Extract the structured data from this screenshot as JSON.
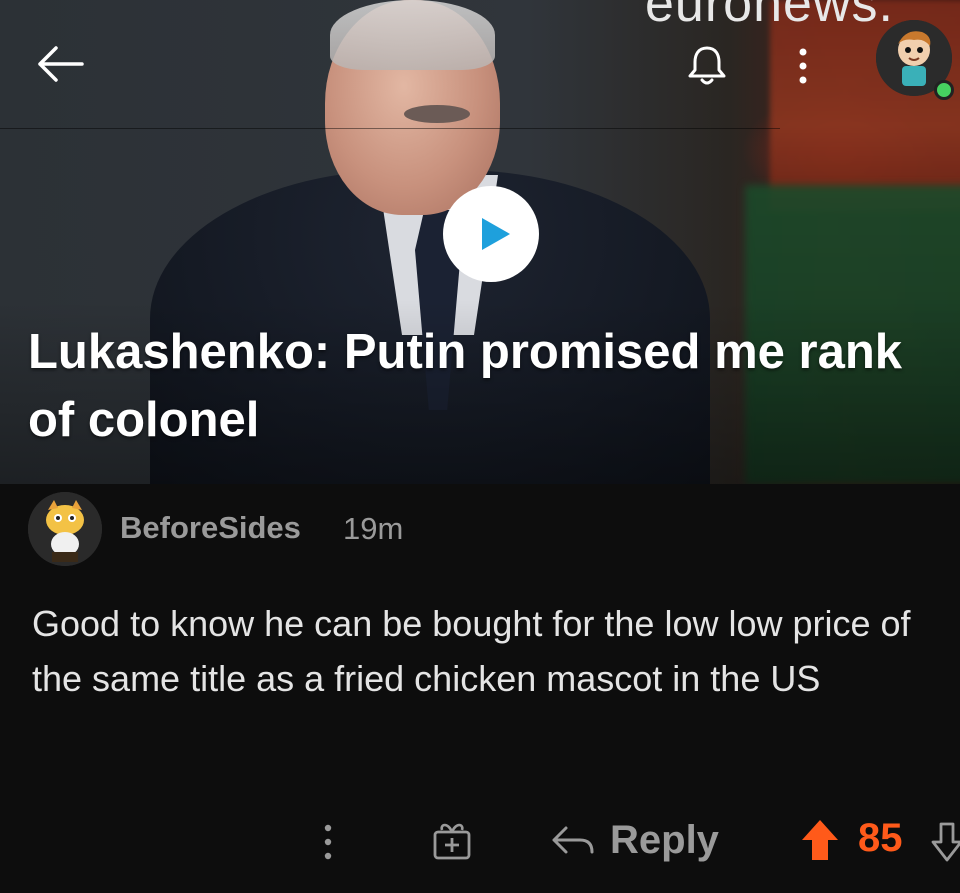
{
  "post": {
    "brand_watermark": "euronews.",
    "headline": "Lukashenko: Putin promised me rank of colonel"
  },
  "comment": {
    "username": "BeforeSides",
    "timestamp": "19m",
    "body": "Good to know he can be bought for the low low price of the same title as a fried chicken mascot in the US",
    "actions": {
      "reply_label": "Reply",
      "score": "85"
    }
  },
  "icons": {
    "back": "back-arrow-icon",
    "notifications": "bell-icon",
    "more": "more-vertical-icon",
    "play": "play-icon",
    "award": "award-gift-icon",
    "reply": "reply-arrow-icon",
    "upvote": "upvote-arrow-icon",
    "downvote": "downvote-arrow-icon"
  },
  "colors": {
    "background": "#0d0d0d",
    "upvote_active": "#ff5a1a",
    "muted_text": "#9a9a9a",
    "online": "#46d160"
  }
}
